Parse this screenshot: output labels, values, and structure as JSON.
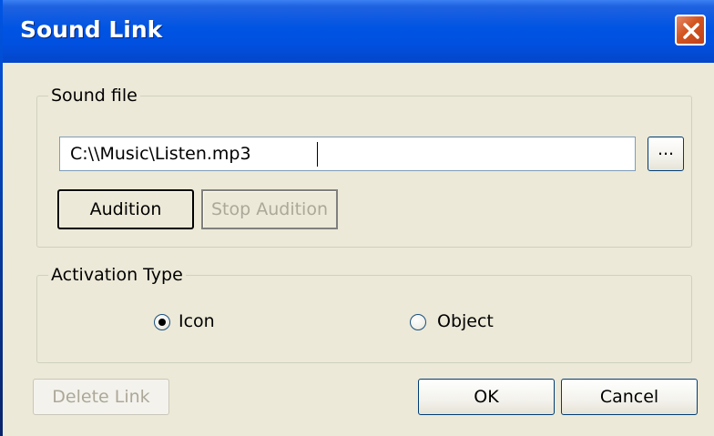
{
  "window": {
    "title": "Sound Link",
    "close_icon": "close-x-icon"
  },
  "sound_file": {
    "group_label": "Sound file",
    "path_value": "C:\\\\Music\\Listen.mp3",
    "browse_label": "...",
    "audition_label": "Audition",
    "stop_audition_label": "Stop Audition"
  },
  "activation": {
    "group_label": "Activation Type",
    "options": [
      {
        "label": "Icon",
        "checked": true
      },
      {
        "label": "Object",
        "checked": false
      }
    ]
  },
  "footer": {
    "delete_label": "Delete Link",
    "ok_label": "OK",
    "cancel_label": "Cancel"
  },
  "colors": {
    "titlebar": "#0054E3",
    "dialog_bg": "#ECE9D8",
    "close_button": "#D2541F",
    "disabled_text": "#ACA899"
  }
}
